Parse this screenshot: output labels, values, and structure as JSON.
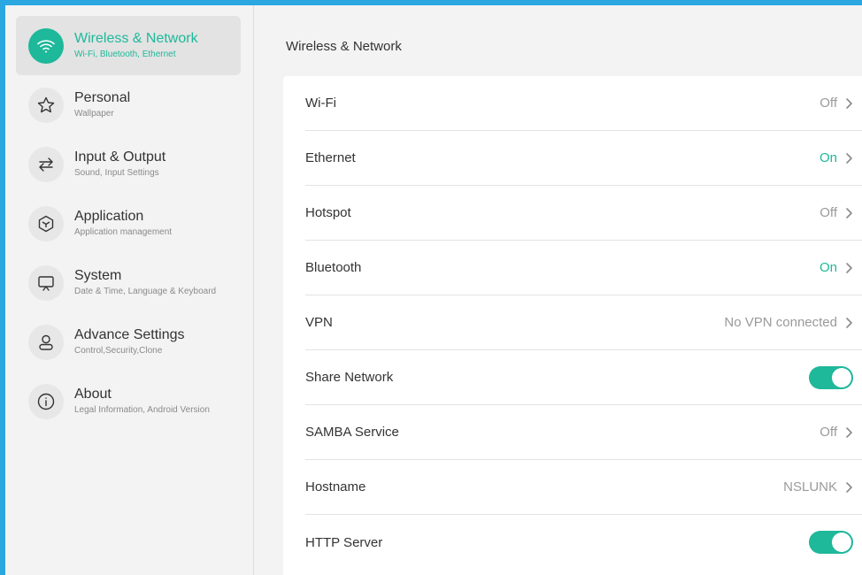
{
  "sidebar": {
    "items": [
      {
        "title": "Wireless & Network",
        "subtitle": "Wi-Fi, Bluetooth, Ethernet",
        "icon": "wifi-icon",
        "active": true
      },
      {
        "title": "Personal",
        "subtitle": "Wallpaper",
        "icon": "star-icon",
        "active": false
      },
      {
        "title": "Input & Output",
        "subtitle": "Sound, Input Settings",
        "icon": "swap-arrows-icon",
        "active": false
      },
      {
        "title": "Application",
        "subtitle": "Application management",
        "icon": "cube-icon",
        "active": false
      },
      {
        "title": "System",
        "subtitle": "Date & Time, Language & Keyboard",
        "icon": "monitor-icon",
        "active": false
      },
      {
        "title": "Advance Settings",
        "subtitle": "Control,Security,Clone",
        "icon": "user-icon",
        "active": false
      },
      {
        "title": "About",
        "subtitle": "Legal Information, Android Version",
        "icon": "info-icon",
        "active": false
      }
    ]
  },
  "main": {
    "title": "Wireless & Network",
    "rows": [
      {
        "label": "Wi-Fi",
        "value": "Off",
        "type": "link",
        "on": false
      },
      {
        "label": "Ethernet",
        "value": "On",
        "type": "link",
        "on": true
      },
      {
        "label": "Hotspot",
        "value": "Off",
        "type": "link",
        "on": false
      },
      {
        "label": "Bluetooth",
        "value": "On",
        "type": "link",
        "on": true
      },
      {
        "label": "VPN",
        "value": "No VPN connected",
        "type": "link",
        "on": false
      },
      {
        "label": "Share Network",
        "value": "",
        "type": "toggle",
        "on": true
      },
      {
        "label": "SAMBA Service",
        "value": "Off",
        "type": "link",
        "on": false
      },
      {
        "label": "Hostname",
        "value": "NSLUNK",
        "type": "link",
        "on": false
      },
      {
        "label": "HTTP Server",
        "value": "",
        "type": "toggle",
        "on": true
      }
    ]
  },
  "colors": {
    "accent": "#1eb89a",
    "frame": "#2aa6e0"
  }
}
